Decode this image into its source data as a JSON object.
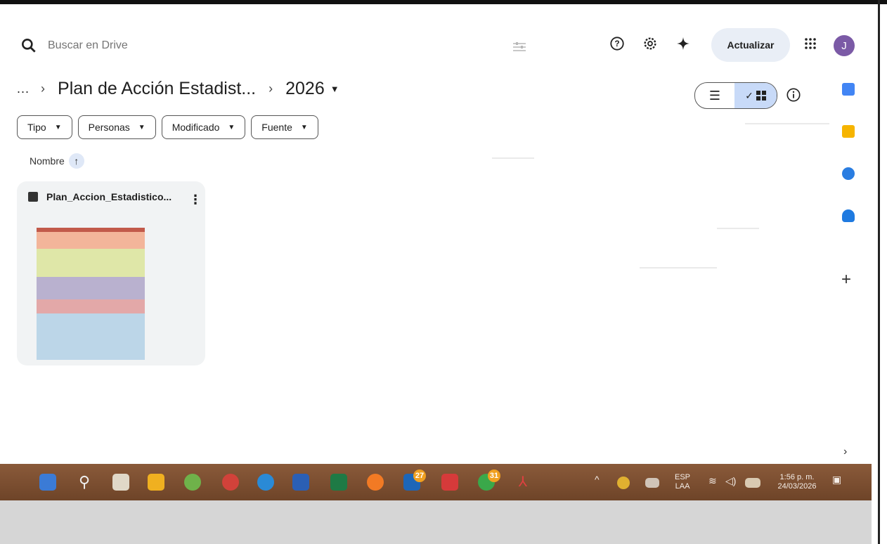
{
  "search": {
    "placeholder": "Buscar en Drive"
  },
  "header": {
    "update_label": "Actualizar",
    "avatar_initial": "J",
    "icons": [
      "help-icon",
      "settings-icon",
      "gemini-icon",
      "apps-grid-icon"
    ]
  },
  "breadcrumb": {
    "more": "...",
    "parent": "Plan de Acción Estadist...",
    "current": "2026"
  },
  "filters": [
    "Tipo",
    "Personas",
    "Modificado",
    "Fuente"
  ],
  "sort": {
    "label": "Nombre"
  },
  "file": {
    "name": "Plan_Accion_Estadistico..."
  },
  "taskbar": {
    "badges": {
      "linkedin": "27",
      "whatsapp": "31"
    },
    "language": [
      "ESP",
      "LAA"
    ],
    "time": "1:56 p. m.",
    "date": "24/03/2026"
  }
}
